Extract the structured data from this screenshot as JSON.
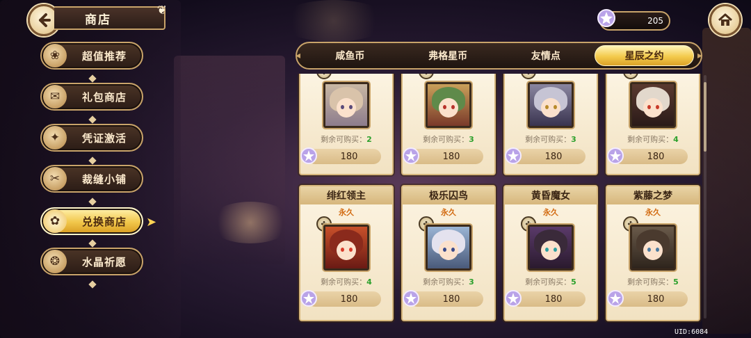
{
  "header": {
    "title": "商店"
  },
  "currency": {
    "icon": "star-gem-icon",
    "amount": "205"
  },
  "sidebar": {
    "items": [
      {
        "label": "超值推荐",
        "icon": "bunny-icon",
        "active": false
      },
      {
        "label": "礼包商店",
        "icon": "gift-box-icon",
        "active": false
      },
      {
        "label": "凭证激活",
        "icon": "card-icon",
        "active": false
      },
      {
        "label": "裁缝小铺",
        "icon": "tailor-icon",
        "active": false
      },
      {
        "label": "兑换商店",
        "icon": "exchange-icon",
        "active": true
      },
      {
        "label": "水晶祈愿",
        "icon": "crystal-icon",
        "active": false
      }
    ]
  },
  "tabs": [
    {
      "label": "咸鱼币",
      "active": false
    },
    {
      "label": "弗格星币",
      "active": false
    },
    {
      "label": "友情点",
      "active": false
    },
    {
      "label": "星辰之约",
      "active": true
    }
  ],
  "remain_label": "剩余可购买：",
  "top_row": [
    {
      "remaining": "2",
      "price": "180"
    },
    {
      "remaining": "3",
      "price": "180"
    },
    {
      "remaining": "3",
      "price": "180"
    },
    {
      "remaining": "4",
      "price": "180"
    }
  ],
  "bottom_row": [
    {
      "name": "绯红领主",
      "duration": "永久",
      "remaining": "4",
      "price": "180"
    },
    {
      "name": "极乐囚鸟",
      "duration": "永久",
      "remaining": "3",
      "price": "180"
    },
    {
      "name": "黄昏魔女",
      "duration": "永久",
      "remaining": "5",
      "price": "180"
    },
    {
      "name": "紫藤之梦",
      "duration": "永久",
      "remaining": "5",
      "price": "180"
    }
  ],
  "uid": "UID:6084",
  "colors": {
    "accent_gold": "#f3ca4c",
    "frame_gold": "#c9a46a",
    "remaining_green": "#2ca02c",
    "duration_orange": "#d26a10"
  }
}
